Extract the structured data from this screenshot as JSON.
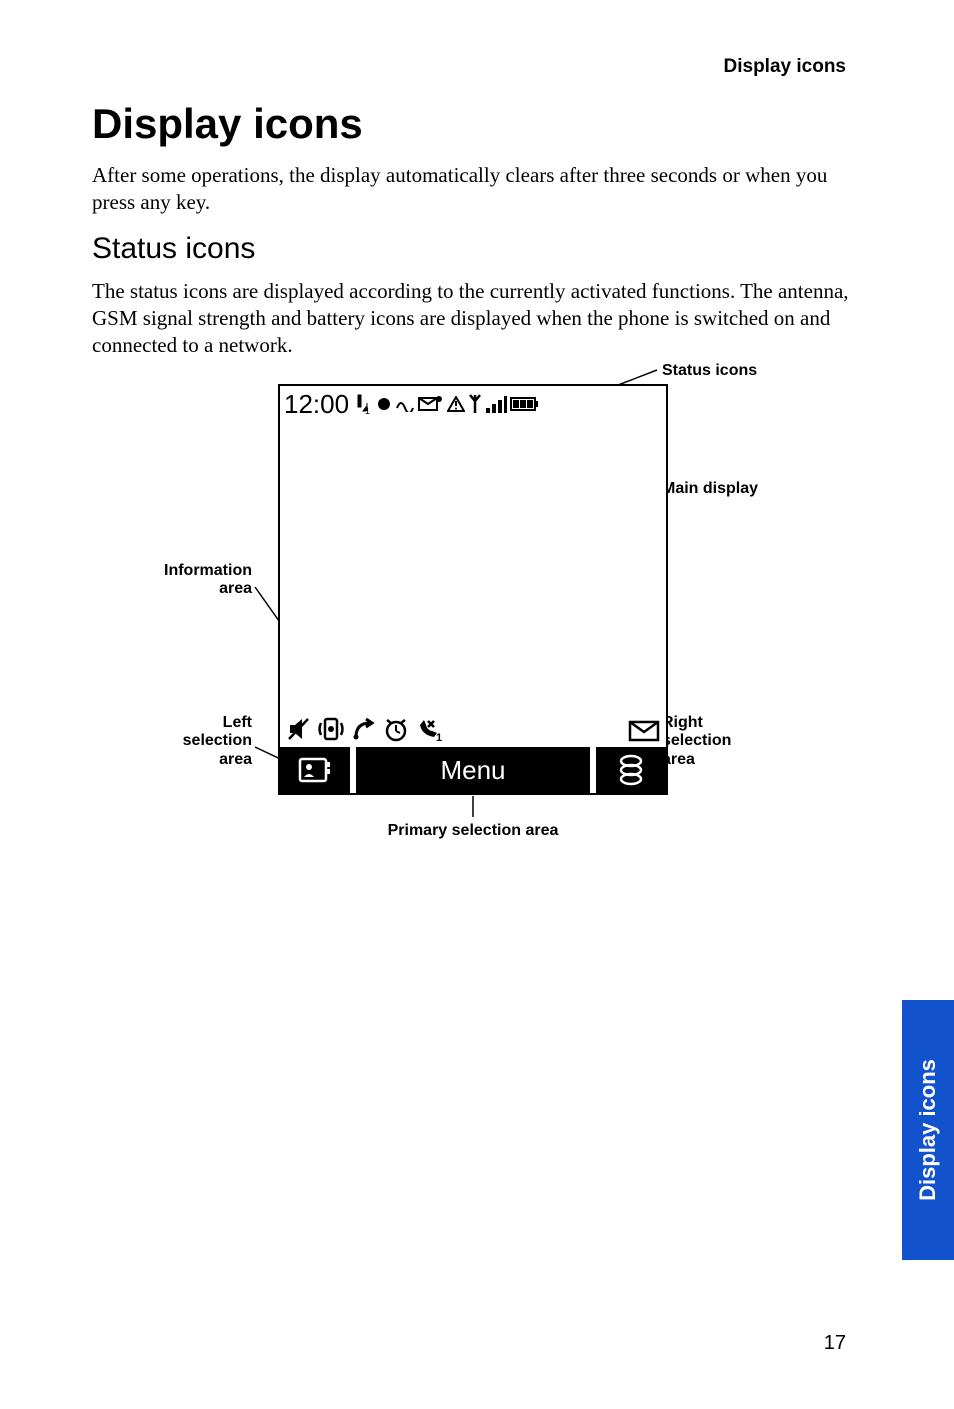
{
  "header": {
    "section": "Display icons"
  },
  "title": "Display icons",
  "intro": "After some operations, the display automatically clears after three seconds or when you press any key.",
  "h2": "Status icons",
  "para2": "The status icons are displayed according to the currently activated functions. The antenna, GSM signal strength and battery icons are displayed when the phone is switched on and connected to a network.",
  "diagram": {
    "callouts": {
      "status_icons": "Status icons",
      "main_display": "Main display",
      "information_area": "Information\narea",
      "left_selection_area": "Left\nselection\narea",
      "right_selection_area": "Right\nselection\narea",
      "primary_selection_area": "Primary selection area"
    },
    "screen": {
      "clock": "12:00",
      "softkey_center": "Menu"
    },
    "icons": {
      "status": [
        "line1-icon",
        "record-icon",
        "alarm-icon",
        "message-unread-icon",
        "warning-icon",
        "antenna-icon",
        "signal-icon",
        "battery-icon"
      ],
      "info_row": [
        "mute-icon",
        "vibrate-icon",
        "divert-icon",
        "alarm-clock-icon",
        "missed-call-icon"
      ],
      "info_right": "envelope-icon",
      "soft_left": "phonebook-icon",
      "soft_right": "web-icon"
    }
  },
  "side_tab": "Display icons",
  "page_number": "17"
}
